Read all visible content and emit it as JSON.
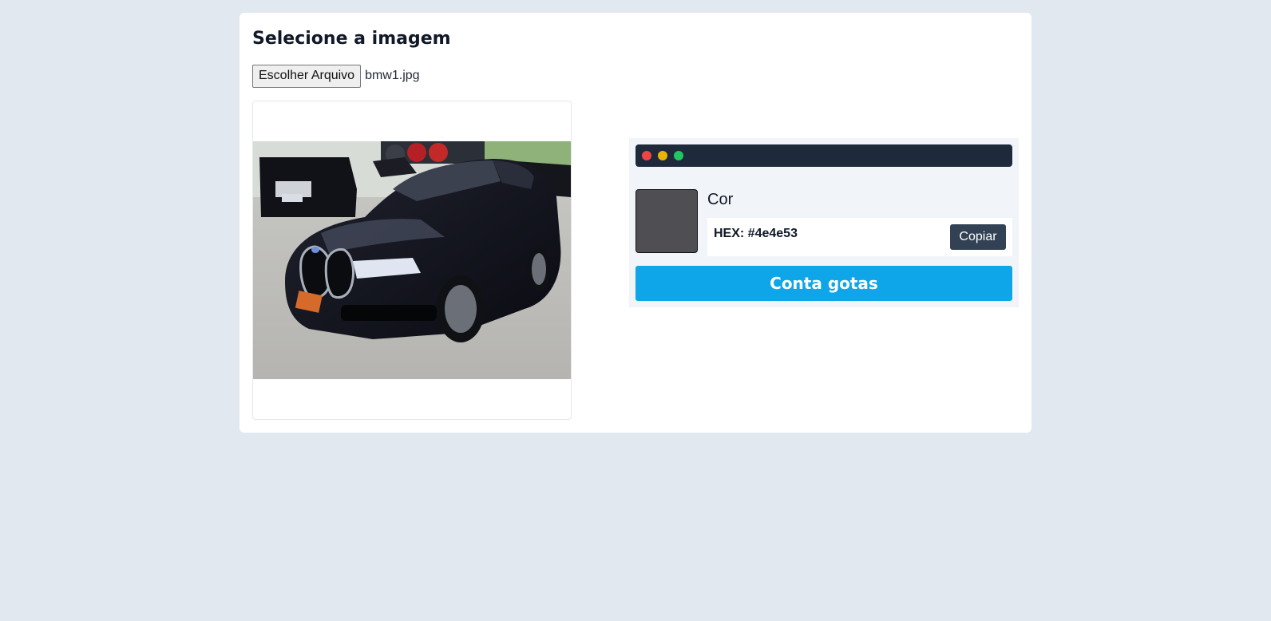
{
  "page": {
    "title": "Selecione a imagem"
  },
  "file_input": {
    "button_label": "Escolher Arquivo",
    "file_name": "bmw1.jpg"
  },
  "image_preview": {
    "alt": "bmw1.jpg"
  },
  "color_picker": {
    "window_dots": [
      "#ef4444",
      "#eab308",
      "#22c55e"
    ],
    "color_label": "Cor",
    "hex_text": "HEX: #4e4e53",
    "swatch_color": "#4e4e53",
    "copy_label": "Copiar",
    "dropper_label": "Conta gotas"
  },
  "colors": {
    "background": "#e2e8f0",
    "titlebar": "#1e293b",
    "accent": "#0ea5e9",
    "copy_button": "#334155"
  }
}
